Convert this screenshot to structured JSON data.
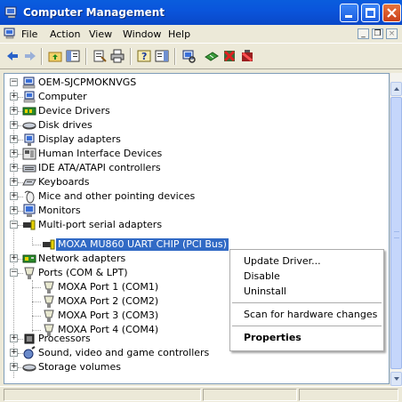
{
  "window": {
    "title": "Computer Management",
    "minimize": "minimize",
    "maximize": "maximize",
    "close": "close"
  },
  "menu": {
    "items": [
      "File",
      "Action",
      "View",
      "Window",
      "Help"
    ],
    "mdi_minimize": "_",
    "mdi_restore": "❐",
    "mdi_close": "×"
  },
  "toolbar": {
    "icons": [
      "back-arrow-icon",
      "forward-arrow-icon",
      "up-folder-icon",
      "show-hide-tree-icon",
      "properties-icon",
      "print-icon",
      "help-icon",
      "show-hide-action-pane-icon",
      "scan-hardware-icon",
      "update-driver-icon",
      "disable-device-icon",
      "uninstall-device-icon"
    ]
  },
  "tree": {
    "root": "OEM-SJCPMOKNVGS",
    "nodes": [
      {
        "label": "Computer",
        "icon": "computer-icon",
        "expander": "+"
      },
      {
        "label": "Device Drivers",
        "icon": "device-drivers-icon",
        "expander": "+"
      },
      {
        "label": "Disk drives",
        "icon": "disk-drive-icon",
        "expander": "+"
      },
      {
        "label": "Display adapters",
        "icon": "display-adapter-icon",
        "expander": "+"
      },
      {
        "label": "Human Interface Devices",
        "icon": "hid-icon",
        "expander": "+"
      },
      {
        "label": "IDE ATA/ATAPI controllers",
        "icon": "ide-controller-icon",
        "expander": "+"
      },
      {
        "label": "Keyboards",
        "icon": "keyboard-icon",
        "expander": "+"
      },
      {
        "label": "Mice and other pointing devices",
        "icon": "mouse-icon",
        "expander": "+"
      },
      {
        "label": "Monitors",
        "icon": "monitor-icon",
        "expander": "+"
      },
      {
        "label": "Multi-port serial adapters",
        "icon": "serial-adapter-icon",
        "expander": "−"
      },
      {
        "label": "Network adapters",
        "icon": "network-adapter-icon",
        "expander": "+"
      },
      {
        "label": "Ports (COM & LPT)",
        "icon": "port-icon",
        "expander": "−"
      },
      {
        "label": "Processors",
        "icon": "processor-icon",
        "expander": "+"
      },
      {
        "label": "Sound, video and game controllers",
        "icon": "sound-icon",
        "expander": "+"
      },
      {
        "label": "Storage volumes",
        "icon": "storage-volume-icon",
        "expander": "+"
      }
    ],
    "selected_child": "MOXA MU860 UART CHIP (PCI Bus)",
    "ports": [
      "MOXA Port 1 (COM1)",
      "MOXA Port 2 (COM2)",
      "MOXA Port 3 (COM3)",
      "MOXA Port 4 (COM4)"
    ]
  },
  "context_menu": {
    "update_driver": "Update Driver...",
    "disable": "Disable",
    "uninstall": "Uninstall",
    "scan": "Scan for hardware changes",
    "properties": "Properties"
  },
  "colors": {
    "titlebar": "#0a55dc",
    "selection": "#316ac5",
    "close_button": "#c9401a"
  }
}
